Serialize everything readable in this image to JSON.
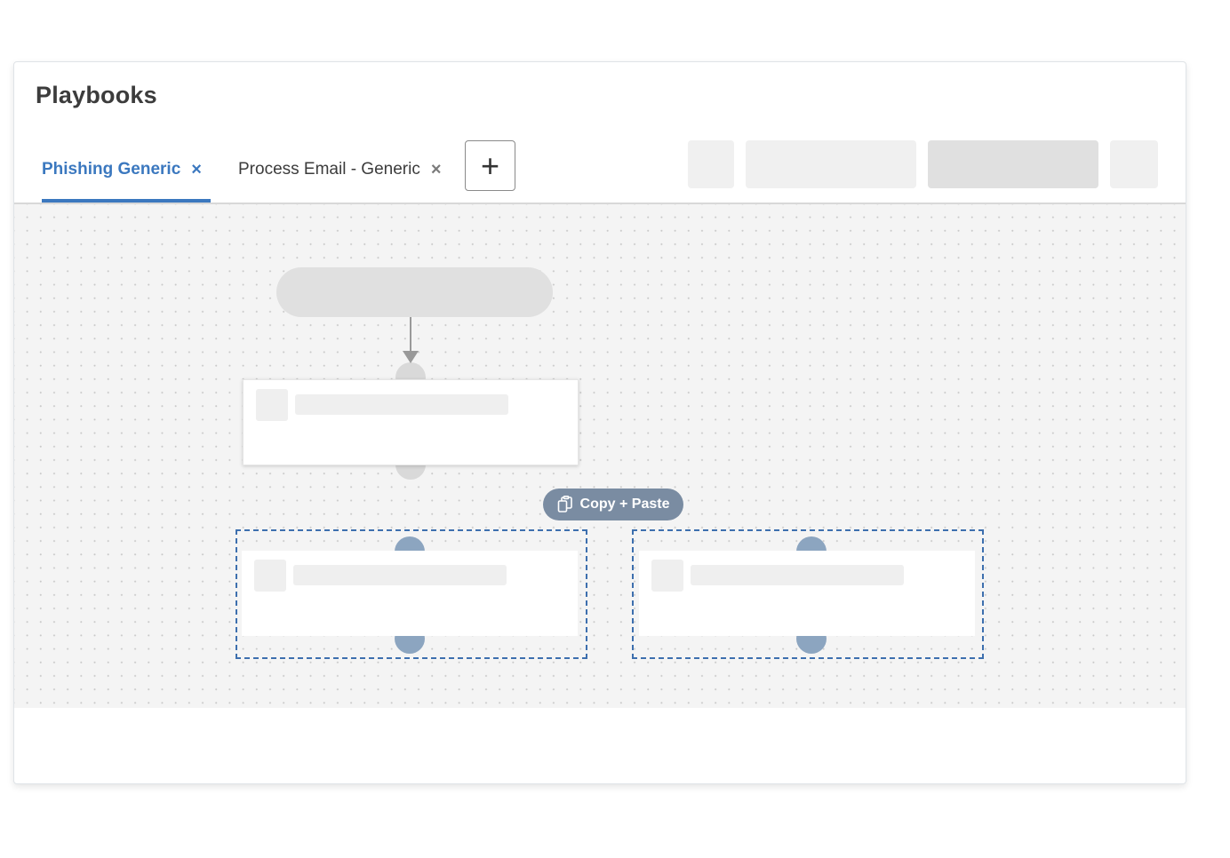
{
  "header": {
    "title": "Playbooks"
  },
  "tabs": [
    {
      "label": "Phishing Generic",
      "close_icon": "×",
      "active": true
    },
    {
      "label": "Process Email - Generic",
      "close_icon": "×",
      "active": false
    }
  ],
  "add_tab": {
    "icon": "+"
  },
  "canvas": {
    "copy_paste_button": {
      "label": "Copy + Paste",
      "icon": "clipboard-copy-icon"
    }
  },
  "colors": {
    "accent": "#3b78bf",
    "selection_border": "#3d6fae",
    "port_selected": "#8ca5c0",
    "copy_paste_bg": "#7a8ca2"
  }
}
